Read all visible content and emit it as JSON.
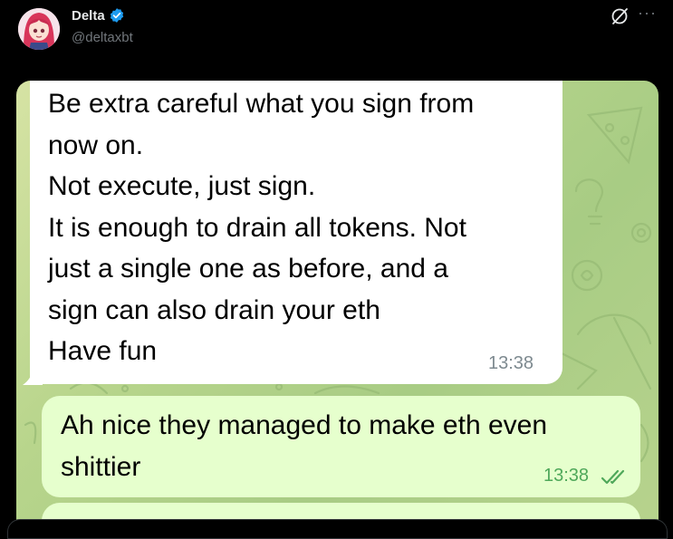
{
  "author": {
    "display_name": "Delta",
    "handle": "@deltaxbt",
    "verified": true,
    "avatar_icon": "anime-avatar-icon"
  },
  "header_actions": {
    "grok_icon": "grok-icon",
    "more_icon": "more-icon",
    "more_label": "···"
  },
  "chat": {
    "incoming": {
      "text": "Be extra careful what you sign from\nnow on.\nNot execute, just sign.\nIt is enough to drain all tokens. Not\njust a single one as before, and a\nsign can also drain your eth\nHave fun",
      "time": "13:38"
    },
    "outgoing": {
      "text": "Ah nice they managed to make eth even\nshittier",
      "time": "13:38",
      "status_icon": "double-check-icon"
    }
  },
  "colors": {
    "background": "#000000",
    "chat_wallpaper": "#b8d58c",
    "incoming_bubble": "#ffffff",
    "outgoing_bubble": "#e6ffcd",
    "verified_badge": "#1d9bf0",
    "read_ticks": "#4fa85a"
  }
}
